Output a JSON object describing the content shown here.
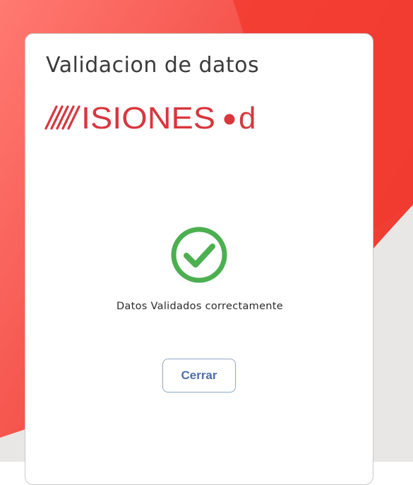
{
  "dialog": {
    "title": "Validacion de datos",
    "logo_text": "MISIONESd",
    "status_message": "Datos Validados correctamente",
    "close_label": "Cerrar"
  },
  "colors": {
    "brand_red": "#d9363e",
    "success_green": "#4caf50",
    "button_text": "#4c6fa8",
    "background_red": "#f23b30"
  },
  "icons": {
    "status": "check-circle-icon"
  }
}
